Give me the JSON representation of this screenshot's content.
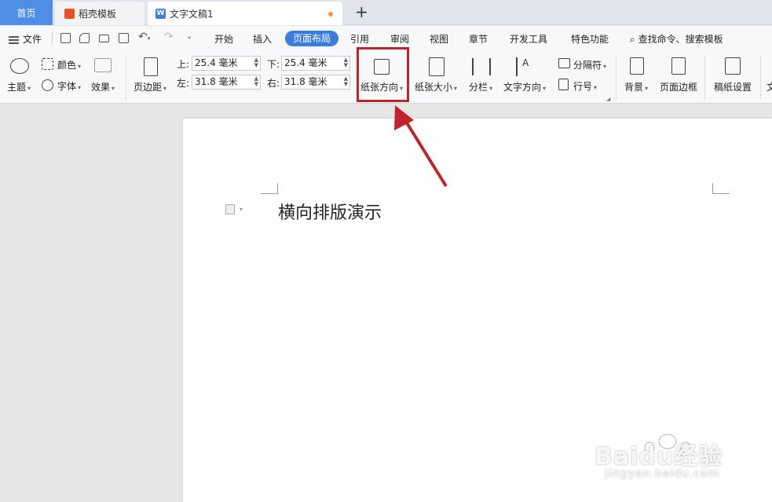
{
  "tabs": {
    "home": "首页",
    "templates": "稻壳模板",
    "document": "文字文稿1",
    "new_tab": "+"
  },
  "menu": {
    "file": "文件",
    "items": [
      "开始",
      "插入",
      "页面布局",
      "引用",
      "审阅",
      "视图",
      "章节",
      "开发工具",
      "特色功能"
    ],
    "active": "页面布局",
    "search": "查找命令、搜索模板"
  },
  "ribbon": {
    "theme": "主题",
    "color": "颜色",
    "font": "字体",
    "effect": "效果",
    "margins": "页边距",
    "margin_top_label": "上:",
    "margin_top_value": "25.4 毫米",
    "margin_bottom_label": "下:",
    "margin_bottom_value": "25.4 毫米",
    "margin_left_label": "左:",
    "margin_left_value": "31.8 毫米",
    "margin_right_label": "右:",
    "margin_right_value": "31.8 毫米",
    "orientation": "纸张方向",
    "paper_size": "纸张大小",
    "columns": "分栏",
    "text_direction": "文字方向",
    "separator": "分隔符",
    "line_number": "行号",
    "background": "背景",
    "page_border": "页面边框",
    "manuscript": "稿纸设置",
    "overflow": "文"
  },
  "document": {
    "body_text": "横向排版演示"
  },
  "watermark": {
    "logo": "Baidu经验",
    "url": "jingyan.baidu.com"
  },
  "colors": {
    "accent": "#3b7ddd",
    "highlight": "#c0232c",
    "home_tab": "#4f8ee6"
  }
}
